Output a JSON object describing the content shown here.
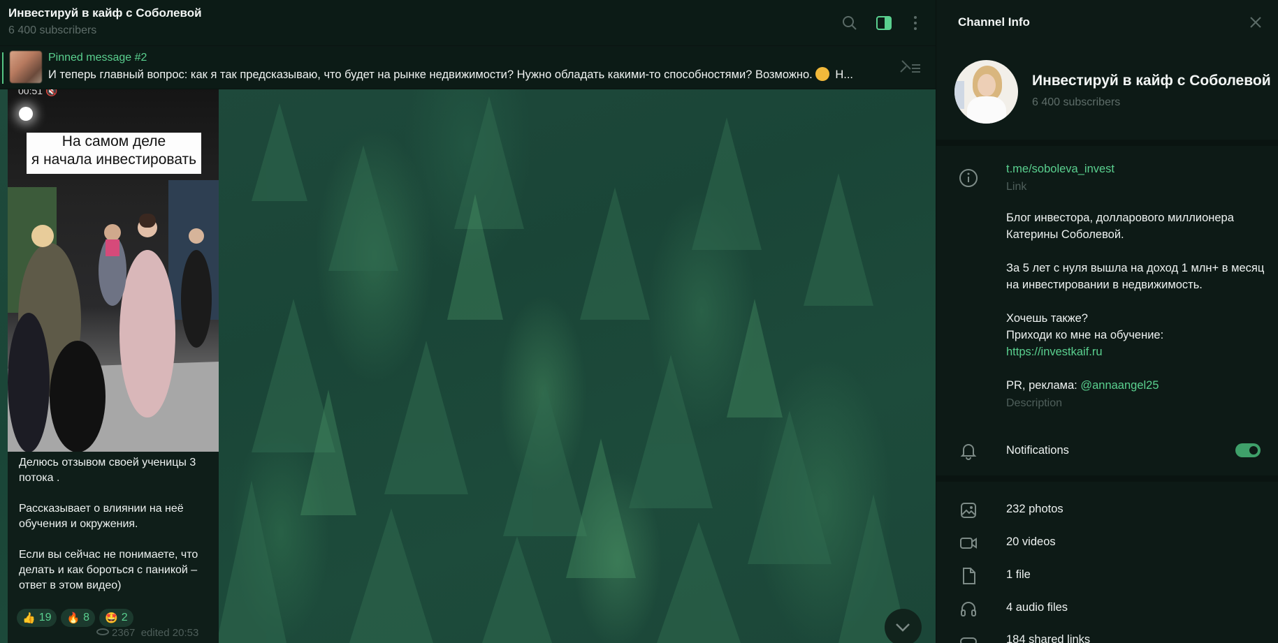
{
  "chat": {
    "title": "Инвестируй в кайф с Соболевой",
    "subscribers": "6 400 subscribers",
    "pinned": {
      "title": "Pinned message #2",
      "text_before": "И теперь главный вопрос: как я так предсказываю, что будет на рынке недвижимости?   Нужно обладать какими-то способностями?  Возможно.",
      "text_after": " Н..."
    },
    "message": {
      "video_time": "00:51",
      "video_caption_line1": "На самом деле",
      "video_caption_line2": "я начала инвестировать",
      "text": "Делюсь отзывом своей ученицы 3 потока .\n\nРассказывает о влиянии на неё обучения и окружения.\n\nЕсли вы сейчас не понимаете, что делать и как бороться с паникой – ответ в этом видео)",
      "reactions": [
        {
          "emoji": "👍",
          "count": "19"
        },
        {
          "emoji": "🔥",
          "count": "8"
        },
        {
          "emoji": "🤩",
          "count": "2"
        }
      ],
      "views": "2367",
      "edited": "edited 20:53"
    }
  },
  "panel": {
    "title": "Channel Info",
    "channel_name": "Инвестируй в кайф с Соболевой",
    "subscribers": "6 400 subscribers",
    "link": "t.me/soboleva_invest",
    "link_label": "Link",
    "desc_line1": "Блог инвестора, долларового миллионера Катерины Соболевой.",
    "desc_line2": "За 5 лет с нуля вышла на доход 1 млн+ в месяц на инвестировании в недвижимость.",
    "desc_line3": "Хочешь также?",
    "desc_line4": "Приходи ко мне на обучение:",
    "desc_link": "https://investkaif.ru",
    "desc_pr": "PR, реклама: ",
    "desc_pr_handle": "@annaangel25",
    "desc_label": "Description",
    "notifications": "Notifications",
    "media": {
      "photos": "232 photos",
      "videos": "20 videos",
      "files": "1 file",
      "audio": "4 audio files",
      "links": "184 shared links"
    }
  },
  "colors": {
    "accent": "#5ad08f",
    "background": "#0d1a16"
  }
}
